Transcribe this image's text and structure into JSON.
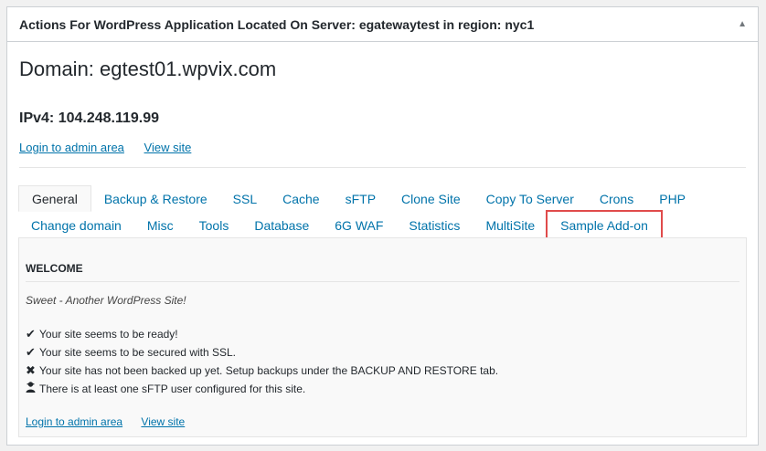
{
  "panel": {
    "title": "Actions For WordPress Application Located On Server: egatewaytest in region: nyc1",
    "toggle_icon": "caret-up-icon"
  },
  "domain": {
    "label": "Domain: egtest01.wpvix.com"
  },
  "ipv4": {
    "label": "IPv4: 104.248.119.99"
  },
  "top_links": {
    "login": "Login to admin area",
    "view": "View site"
  },
  "tabs": {
    "row1": [
      "General",
      "Backup & Restore",
      "SSL",
      "Cache",
      "sFTP",
      "Clone Site",
      "Copy To Server",
      "Crons",
      "PHP"
    ],
    "row2": [
      "Change domain",
      "Misc",
      "Tools",
      "Database",
      "6G WAF",
      "Statistics",
      "MultiSite",
      "Sample Add-on"
    ],
    "active": "General",
    "highlighted": "Sample Add-on"
  },
  "content": {
    "heading": "WELCOME",
    "tagline": "Sweet - Another WordPress Site!",
    "items": [
      {
        "icon": "checkmark-icon",
        "text": "Your site seems to be ready!"
      },
      {
        "icon": "checkmark-icon",
        "text": "Your site seems to be secured with SSL."
      },
      {
        "icon": "x-mark-icon",
        "text": "Your site has not been backed up yet. Setup backups under the BACKUP AND RESTORE tab."
      },
      {
        "icon": "user-secret-icon",
        "text": "There is at least one sFTP user configured for this site."
      }
    ],
    "links": {
      "login": "Login to admin area",
      "view": "View site"
    }
  },
  "colors": {
    "link": "#0073aa",
    "highlight_border": "#e04b4b",
    "border": "#ccd0d4"
  }
}
